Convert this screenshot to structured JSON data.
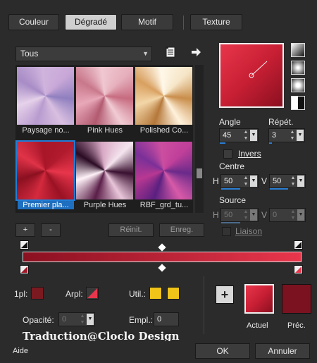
{
  "tabs": [
    {
      "label": "Couleur"
    },
    {
      "label": "Dégradé"
    },
    {
      "label": "Motif"
    },
    {
      "label": "Texture"
    }
  ],
  "category": {
    "selected": "Tous"
  },
  "gradients": [
    {
      "name": "Paysage no..."
    },
    {
      "name": "Pink Hues"
    },
    {
      "name": "Polished Co..."
    },
    {
      "name": "Premier pla..."
    },
    {
      "name": "Purple Hues"
    },
    {
      "name": "RBF_grd_tu..."
    }
  ],
  "list_buttons": {
    "add": "+",
    "remove": "-",
    "reset": "Réinit.",
    "save": "Enreg."
  },
  "params": {
    "angle_label": "Angle",
    "angle_value": "45",
    "repeat_label": "Répét.",
    "repeat_value": "3",
    "invert_label": "Invers",
    "center_label": "Centre",
    "center_h_label": "H",
    "center_h_value": "50",
    "center_v_label": "V",
    "center_v_value": "50",
    "source_label": "Source",
    "source_h_label": "H",
    "source_h_value": "50",
    "source_v_label": "V",
    "source_v_value": "0",
    "link_label": "Liaison"
  },
  "stops": {
    "fpl_label": "1pl:",
    "arpl_label": "Arpl:",
    "util_label": "Util.:",
    "opacity_label": "Opacité:",
    "opacity_value": "0",
    "empl_label": "Empl.:",
    "empl_value": "0"
  },
  "preview": {
    "current_label": "Actuel",
    "previous_label": "Préc."
  },
  "watermark": "Traduction@Cloclo Design",
  "footer": {
    "help": "Aide",
    "ok": "OK",
    "cancel": "Annuler"
  },
  "colors": {
    "accent": "#1f7ed6",
    "gradient_dark": "#8a1020",
    "gradient_light": "#e8364c",
    "util_yellow": "#f0c419",
    "previous": "#7a1220"
  }
}
